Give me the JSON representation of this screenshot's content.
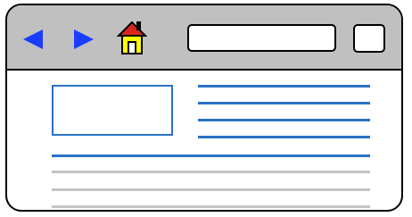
{
  "colors": {
    "toolbar": "#c0c0c0",
    "nav_arrows": "#1a3cff",
    "content_lines": "#2a72c6",
    "text_lines": "#c4c4c4",
    "home_roof": "#d8261c",
    "home_walls": "#ffff00"
  },
  "toolbar": {
    "back_icon": "back-arrow-icon",
    "forward_icon": "forward-arrow-icon",
    "home_icon": "home-icon",
    "address_value": ""
  }
}
